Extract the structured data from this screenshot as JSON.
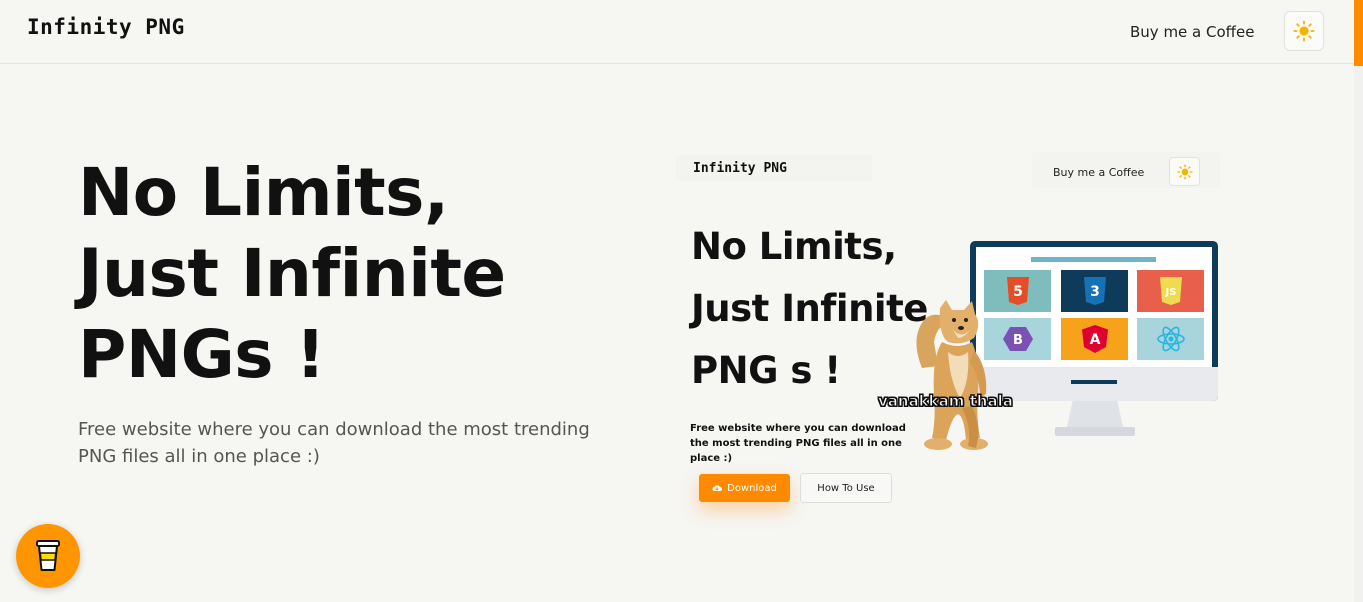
{
  "header": {
    "logo": "Infinity PNG",
    "coffee_link": "Buy me a Coffee",
    "theme_icon": "sun-icon"
  },
  "hero": {
    "title_lines": [
      "No Limits,",
      "Just Infinite",
      "PNGs !"
    ],
    "subtitle": "Free website where you can download the most trending PNG files all in one place :)"
  },
  "floating_button": {
    "icon": "coffee-cup-icon"
  },
  "preview": {
    "logo": "Infinity PNG",
    "coffee_link": "Buy me a Coffee",
    "title_lines": [
      "No Limits,",
      "Just Infinite",
      "PNG s !"
    ],
    "subtitle": "Free website where you can download the most trending PNG files all in one place :)",
    "download_label": "Download",
    "howto_label": "How To Use",
    "meme_caption": "vanakkam thala",
    "tiles": [
      {
        "name": "html5-icon",
        "label": "5",
        "bg": "#7fbcbc",
        "fg": "#e44d26"
      },
      {
        "name": "css3-icon",
        "label": "3",
        "bg": "#0f3b5a",
        "fg": "#1572b6"
      },
      {
        "name": "js-icon",
        "label": "JS",
        "bg": "#e8604c",
        "fg": "#f0db4f"
      },
      {
        "name": "bootstrap-icon",
        "label": "B",
        "bg": "#a8d5dc",
        "fg": "#7952b3"
      },
      {
        "name": "angular-icon",
        "label": "A",
        "bg": "#f7a21b",
        "fg": "#dd0031"
      },
      {
        "name": "react-icon",
        "label": "⚛",
        "bg": "#a8d5dc",
        "fg": "#28b6e0"
      }
    ]
  },
  "colors": {
    "accent": "#ff8a00",
    "background": "#f6f6f3",
    "sun": "#f5b400"
  }
}
